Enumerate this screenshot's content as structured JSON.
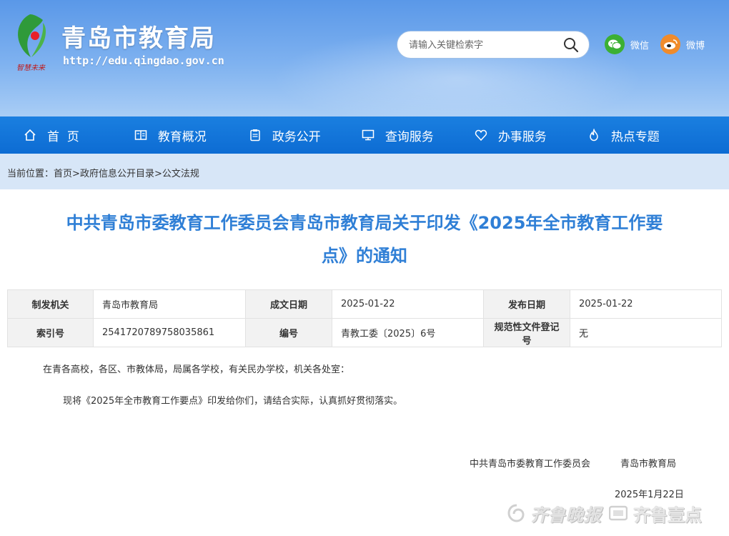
{
  "header": {
    "site_title": "青岛市教育局",
    "site_url": "http://edu.qingdao.gov.cn",
    "logo_text": "智慧未来",
    "search_placeholder": "请输入关键检索字",
    "social": [
      {
        "label": "微信",
        "icon": "wechat-icon",
        "color": "#3cb034"
      },
      {
        "label": "微博",
        "icon": "weibo-icon",
        "color": "#f08b2b"
      }
    ]
  },
  "nav": [
    {
      "label": "首  页",
      "icon": "home-icon"
    },
    {
      "label": "教育概况",
      "icon": "book-icon"
    },
    {
      "label": "政务公开",
      "icon": "clipboard-icon"
    },
    {
      "label": "查询服务",
      "icon": "monitor-icon"
    },
    {
      "label": "办事服务",
      "icon": "heart-icon"
    },
    {
      "label": "热点专题",
      "icon": "flame-icon"
    }
  ],
  "breadcrumb": {
    "prefix": "当前位置：",
    "items": [
      "首页",
      "政府信息公开目录",
      "公文法规"
    ],
    "sep": ">"
  },
  "article": {
    "title_line1": "中共青岛市委教育工作委员会青岛市教育局关于印发《2025年全市教育工作要",
    "title_line2": "点》的通知",
    "meta": {
      "issuer_label": "制发机关",
      "issuer": "青岛市教育局",
      "written_label": "成文日期",
      "written": "2025-01-22",
      "published_label": "发布日期",
      "published": "2025-01-22",
      "index_label": "索引号",
      "index": "2541720789758035861",
      "number_label": "编号",
      "number": "青教工委〔2025〕6号",
      "registry_label": "规范性文件登记号",
      "registry": "无"
    },
    "para1": "在青各高校，各区、市教体局，局属各学校，有关民办学校，机关各处室：",
    "para2": "现将《2025年全市教育工作要点》印发给你们，请结合实际，认真抓好贯彻落实。",
    "sign1": "中共青岛市委教育工作委员会",
    "sign2": "青岛市教育局",
    "date": "2025年1月22日"
  },
  "watermark": {
    "brand_script": "齐鲁晚报",
    "brand_app": "齐鲁壹点"
  },
  "colors": {
    "nav_bg": "#0d6cd3",
    "title": "#2f7fd6",
    "crumb_bg": "#d7e6f7"
  }
}
